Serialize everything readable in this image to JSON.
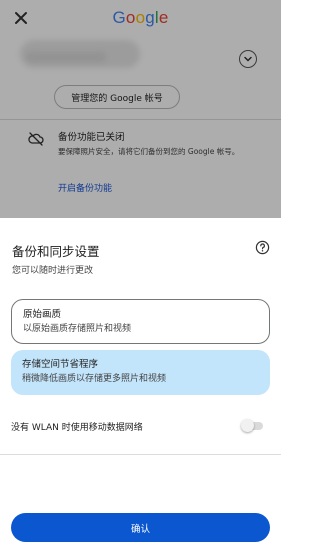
{
  "header": {
    "logo_letters": [
      {
        "char": "G",
        "color": "#4285F4"
      },
      {
        "char": "o",
        "color": "#EA4335"
      },
      {
        "char": "o",
        "color": "#FBBC05"
      },
      {
        "char": "g",
        "color": "#4285F4"
      },
      {
        "char": "l",
        "color": "#34A853"
      },
      {
        "char": "e",
        "color": "#EA4335"
      }
    ],
    "close_icon": "close-icon",
    "expand_icon": "chevron-down-icon"
  },
  "account": {
    "manage_label": "管理您的 Google 帐号"
  },
  "backup": {
    "icon": "cloud-off-icon",
    "title": "备份功能已关闭",
    "description": "要保障照片安全，请将它们备份到您的 Google 帐号。",
    "link": "开启备份功能"
  },
  "sheet": {
    "title": "备份和同步设置",
    "subtitle": "您可以随时进行更改",
    "help_icon": "help-icon",
    "options": [
      {
        "title": "原始画质",
        "description": "以原始画质存储照片和视频",
        "selected": false
      },
      {
        "title": "存储空间节省程序",
        "description": "稍微降低画质以存储更多照片和视频",
        "selected": true
      }
    ],
    "wlan_label": "没有 WLAN 时使用移动数据网络",
    "wlan_enabled": false,
    "confirm_label": "确认"
  },
  "colors": {
    "accent": "#0b57d0",
    "selected_option": "#c3e5fb",
    "link": "#1a56d6"
  }
}
